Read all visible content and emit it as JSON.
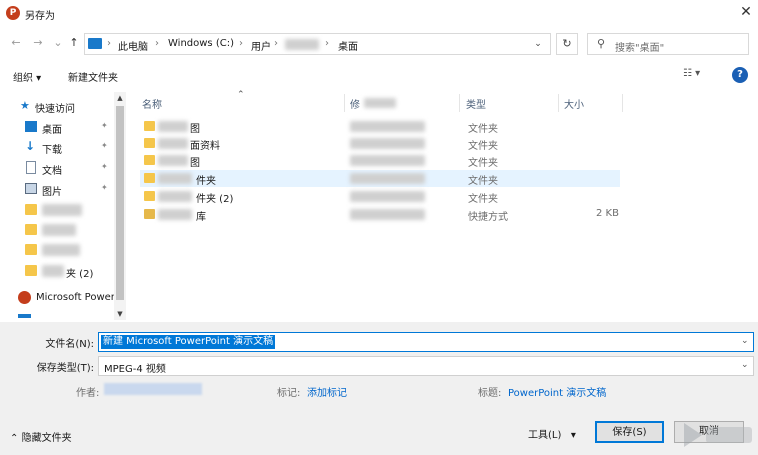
{
  "window": {
    "title": "另存为",
    "app_icon": "powerpoint-icon",
    "close_glyph": "✕"
  },
  "nav": {
    "back_glyph": "←",
    "forward_glyph": "→",
    "recent_glyph": "⌄",
    "up_glyph": "↑",
    "breadcrumb": [
      "此电脑",
      "Windows (C:)",
      "用户",
      "桌面"
    ],
    "separator": "›",
    "dropdown_glyph": "⌄",
    "refresh_glyph": "↻",
    "search_placeholder": "搜索\"桌面\""
  },
  "toolbar": {
    "organize": "组织",
    "new_folder": "新建文件夹",
    "view_glyph": "☷ ▾",
    "help": "?"
  },
  "sidebar": {
    "items": [
      {
        "label": "快速访问",
        "icon": "star-icon"
      },
      {
        "label": "桌面",
        "icon": "desktop-icon",
        "pinned": true
      },
      {
        "label": "下载",
        "icon": "download-icon",
        "pinned": true
      },
      {
        "label": "文档",
        "icon": "document-icon",
        "pinned": true
      },
      {
        "label": "图片",
        "icon": "picture-icon",
        "pinned": true
      },
      {
        "label": "夹 (2)",
        "icon": "folder-icon"
      },
      {
        "label": "Microsoft Power",
        "icon": "powerpoint-icon"
      }
    ],
    "pin_glyph": "📌"
  },
  "columns": {
    "name": "名称",
    "date": "修",
    "type": "类型",
    "size": "大小"
  },
  "files": [
    {
      "name": "图",
      "type": "文件夹",
      "size": ""
    },
    {
      "name": "面资料",
      "type": "文件夹",
      "size": ""
    },
    {
      "name": "图",
      "type": "文件夹",
      "size": ""
    },
    {
      "name": "件夹",
      "type": "文件夹",
      "size": ""
    },
    {
      "name": "件夹 (2)",
      "type": "文件夹",
      "size": ""
    },
    {
      "name": "库",
      "type": "快捷方式",
      "size": "2 KB"
    }
  ],
  "form": {
    "filename_label": "文件名(N):",
    "filename_value": "新建 Microsoft PowerPoint 演示文稿",
    "filetype_label": "保存类型(T):",
    "filetype_value": "MPEG-4 视频",
    "author_label": "作者:",
    "tags_label": "标记:",
    "tags_link": "添加标记",
    "title_label": "标题:",
    "title_link": "PowerPoint 演示文稿"
  },
  "footer": {
    "hide_folders": "隐藏文件夹",
    "hide_glyph": "⌃",
    "tools": "工具(L)",
    "tools_glyph": "▾",
    "save": "保存(S)",
    "cancel": "取消"
  }
}
